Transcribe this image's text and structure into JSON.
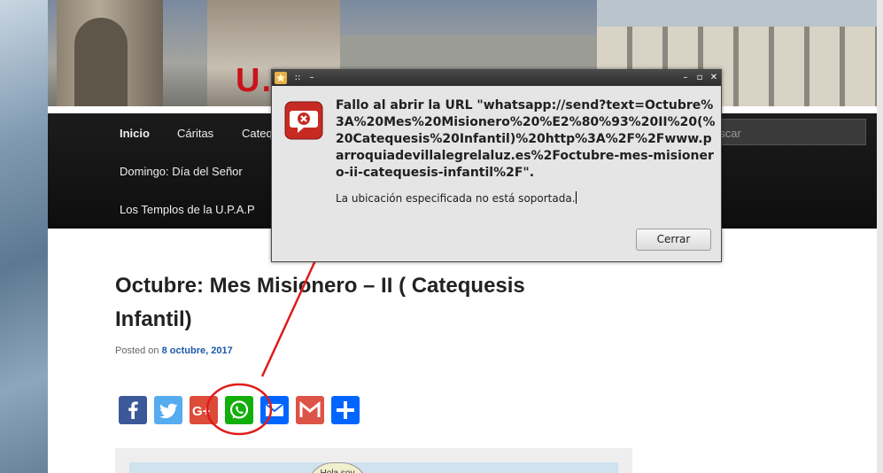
{
  "header": {
    "site_title": "U..."
  },
  "nav": {
    "items": [
      {
        "label": "Inicio",
        "active": true
      },
      {
        "label": "Cáritas"
      },
      {
        "label": "Cateq"
      },
      {
        "label": "Domingo: Día del Señor"
      },
      {
        "label": "Los Templos de la U.P.A.P"
      }
    ],
    "search_placeholder": "uscar"
  },
  "article": {
    "title": "Octubre: Mes Misionero – II ( Catequesis Infantil)",
    "posted_prefix": "Posted on",
    "posted_date": "8 octubre, 2017",
    "share_buttons": [
      {
        "icon": "facebook-icon",
        "color": "#3b5998"
      },
      {
        "icon": "twitter-icon",
        "color": "#55acee"
      },
      {
        "icon": "google-plus-icon",
        "color": "#dd4b39"
      },
      {
        "icon": "whatsapp-icon",
        "color": "#12af0a"
      },
      {
        "icon": "email-icon",
        "color": "#0166ff"
      },
      {
        "icon": "gmail-icon",
        "color": "#dd5347"
      },
      {
        "icon": "share-add-icon",
        "color": "#0166ff"
      }
    ],
    "image_bubble_text": "Hola soy"
  },
  "dialog": {
    "title_buttons": [
      "::",
      "–",
      "▫",
      "✕"
    ],
    "error_title": "Fallo al abrir la URL \"whatsapp://send?text=Octubre%3A%20Mes%20Misionero%20%E2%80%93%20II%20(%20Catequesis%20Infantil)%20http%3A%2F%2Fwww.parroquiadevillalegrelaluz.es%2Foctubre-mes-misionero-ii-catequesis-infantil%2F\".",
    "message": "La ubicación especificada no está soportada.",
    "close_button": "Cerrar"
  },
  "colors": {
    "annotation": "#e01b1b",
    "nav_bg": "#141414",
    "link": "#1b5aa8"
  }
}
